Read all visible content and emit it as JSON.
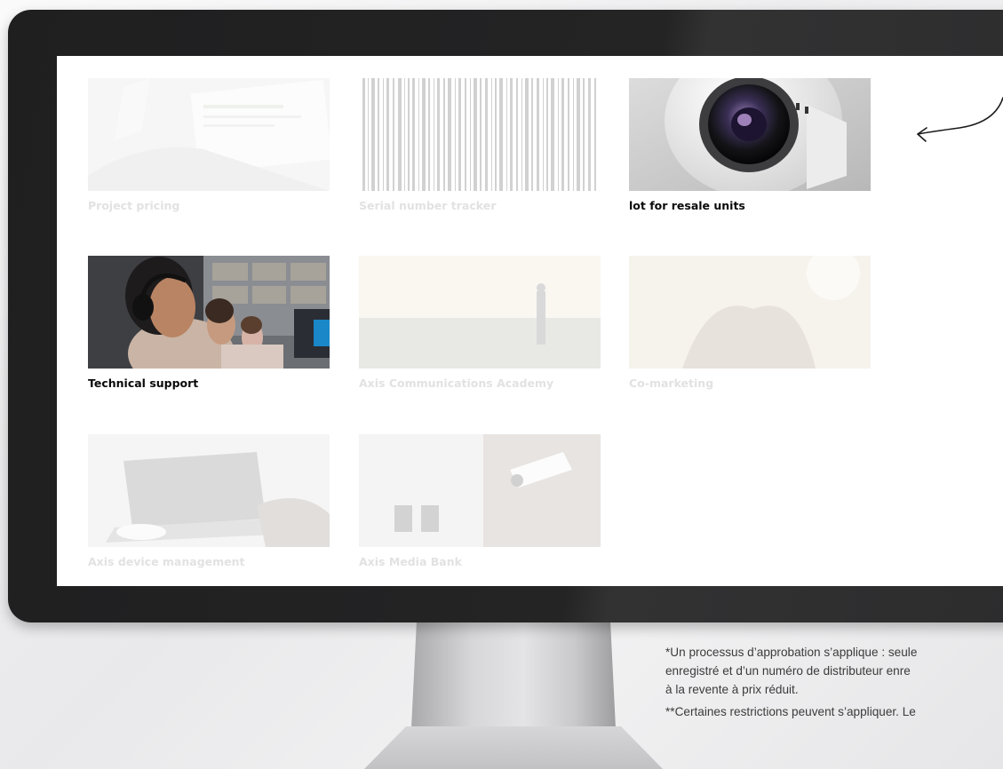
{
  "tiles": [
    {
      "label": "Project pricing",
      "state": "faded"
    },
    {
      "label": "Serial number tracker",
      "state": "faded"
    },
    {
      "label": "lot for resale units",
      "state": "active"
    },
    {
      "label": "Technical support",
      "state": "active"
    },
    {
      "label": "Axis Communications Academy",
      "state": "faded"
    },
    {
      "label": "Co-marketing",
      "state": "faded"
    },
    {
      "label": "Axis device management",
      "state": "faded"
    },
    {
      "label": "Axis Media Bank",
      "state": "faded"
    }
  ],
  "footnotes": {
    "line1": "*Un processus d’approbation s’applique : seule",
    "line2": "enregistré et d’un numéro de distributeur enre",
    "line3": "à la revente à prix réduit.",
    "line4": "**Certaines restrictions peuvent s’appliquer. Le"
  },
  "colors": {
    "bezel": "#232324",
    "screen": "#ffffff",
    "active_caption": "#0a0a0a",
    "faded_caption": "#e2e2e2"
  },
  "icons": {
    "annotation": "curved-arrow-icon"
  }
}
